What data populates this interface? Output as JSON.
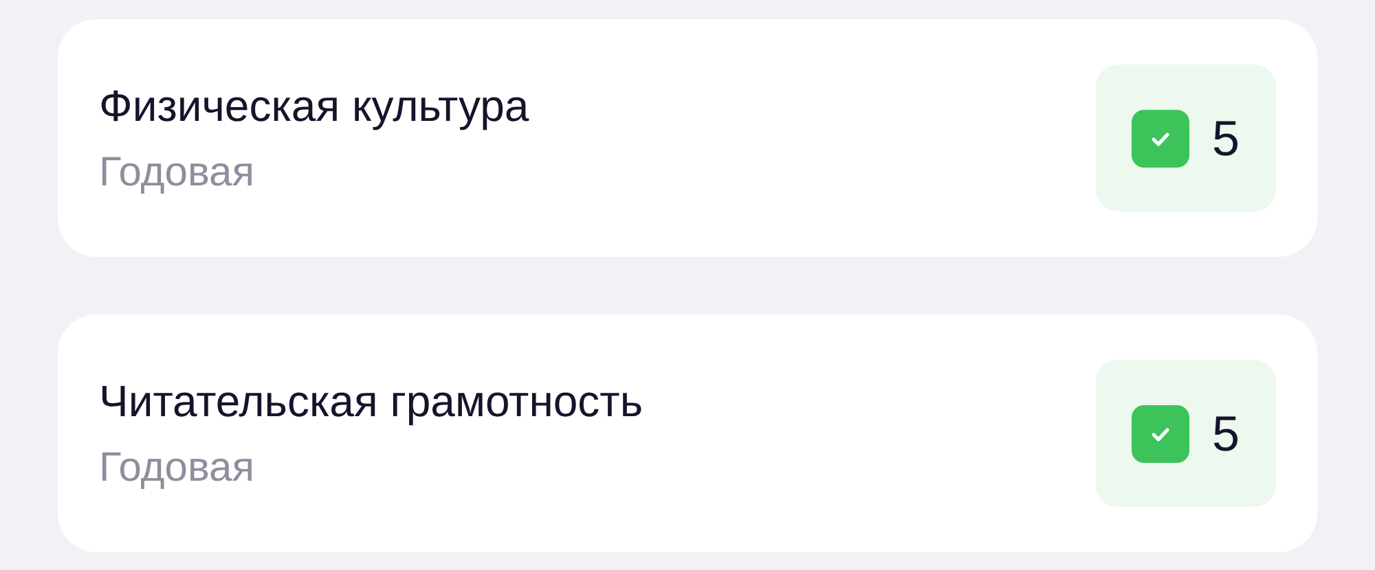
{
  "subjects": [
    {
      "name": "Физическая культура",
      "period": "Годовая",
      "grade": "5",
      "checked": true
    },
    {
      "name": "Читательская грамотность",
      "period": "Годовая",
      "grade": "5",
      "checked": true
    }
  ]
}
